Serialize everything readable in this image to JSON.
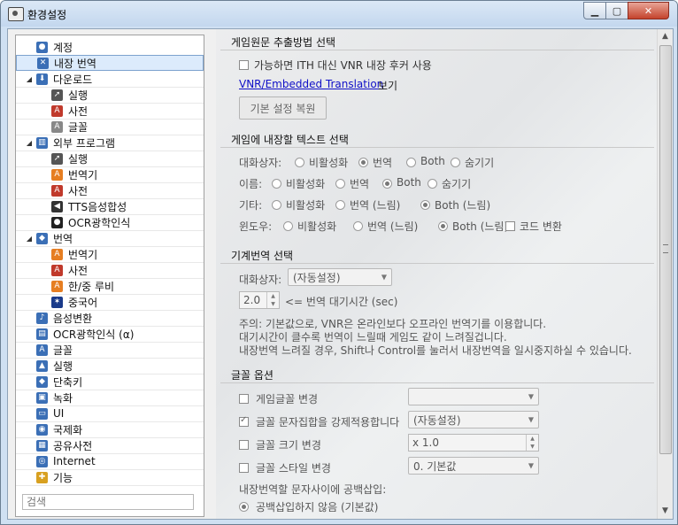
{
  "window": {
    "title": "환경설정"
  },
  "sidebar": {
    "search_placeholder": "검색",
    "items": [
      {
        "label": "계정",
        "icon": "user-icon",
        "color": "#3b6fb6",
        "level": 0
      },
      {
        "label": "내장 번역",
        "icon": "tools-icon",
        "color": "#3b6fb6",
        "level": 0,
        "selected": true
      },
      {
        "label": "다운로드",
        "icon": "download-icon",
        "color": "#3b6fb6",
        "level": 0,
        "expanded": true
      },
      {
        "label": "실행",
        "icon": "rocket-icon",
        "color": "#555555",
        "level": 1
      },
      {
        "label": "사전",
        "icon": "dictionary-icon",
        "color": "#c0392b",
        "level": 1
      },
      {
        "label": "글꼴",
        "icon": "font-icon",
        "color": "#888888",
        "level": 1
      },
      {
        "label": "외부 프로그램",
        "icon": "building-icon",
        "color": "#3b6fb6",
        "level": 0,
        "expanded": true
      },
      {
        "label": "실행",
        "icon": "rocket-icon",
        "color": "#555555",
        "level": 1
      },
      {
        "label": "번역기",
        "icon": "translator-icon",
        "color": "#e67e22",
        "level": 1
      },
      {
        "label": "사전",
        "icon": "dictionary-icon",
        "color": "#c0392b",
        "level": 1
      },
      {
        "label": "TTS음성합성",
        "icon": "speaker-icon",
        "color": "#333333",
        "level": 1
      },
      {
        "label": "OCR광학인식",
        "icon": "camera-icon",
        "color": "#222222",
        "level": 1
      },
      {
        "label": "번역",
        "icon": "people-icon",
        "color": "#3b6fb6",
        "level": 0,
        "expanded": true
      },
      {
        "label": "번역기",
        "icon": "translator-icon",
        "color": "#e67e22",
        "level": 1
      },
      {
        "label": "사전",
        "icon": "dictionary-icon",
        "color": "#c0392b",
        "level": 1
      },
      {
        "label": "한/중 루비",
        "icon": "translator-icon",
        "color": "#e67e22",
        "level": 1
      },
      {
        "label": "중국어",
        "icon": "star-icon",
        "color": "#1a3a8a",
        "level": 1
      },
      {
        "label": "음성변환",
        "icon": "music-icon",
        "color": "#3b6fb6",
        "level": 0
      },
      {
        "label": "OCR광학인식 (α)",
        "icon": "ocr-icon",
        "color": "#3b6fb6",
        "level": 0
      },
      {
        "label": "글꼴",
        "icon": "font-icon",
        "color": "#3b6fb6",
        "level": 0
      },
      {
        "label": "실행",
        "icon": "run-icon",
        "color": "#3b6fb6",
        "level": 0
      },
      {
        "label": "단축키",
        "icon": "shortcut-icon",
        "color": "#3b6fb6",
        "level": 0
      },
      {
        "label": "녹화",
        "icon": "record-icon",
        "color": "#3b6fb6",
        "level": 0
      },
      {
        "label": "UI",
        "icon": "ui-icon",
        "color": "#3b6fb6",
        "level": 0
      },
      {
        "label": "국제화",
        "icon": "globe-icon",
        "color": "#3b6fb6",
        "level": 0
      },
      {
        "label": "공유사전",
        "icon": "share-icon",
        "color": "#3b6fb6",
        "level": 0
      },
      {
        "label": "Internet",
        "icon": "internet-icon",
        "color": "#3b6fb6",
        "level": 0
      },
      {
        "label": "기능",
        "icon": "feature-icon",
        "color": "#d8a020",
        "level": 0
      }
    ]
  },
  "extract": {
    "title": "게임원문 추출방법 선택",
    "checkbox_label": "가능하면 ITH 대신 VNR 내장 후커 사용",
    "link_text": "VNR/Embedded Translation",
    "link_suffix": "보기",
    "reset_button": "기본 설정 복원"
  },
  "embed_text": {
    "title": "게임에 내장할 텍스트 선택",
    "rows": [
      {
        "label": "대화상자:",
        "options": [
          "비활성화",
          "번역",
          "Both",
          "숨기기"
        ],
        "selected": 1
      },
      {
        "label": "이름:",
        "options": [
          "비활성화",
          "번역",
          "Both",
          "숨기기"
        ],
        "selected": 2
      },
      {
        "label": "기타:",
        "options": [
          "비활성화",
          "번역 (느림)",
          "Both (느림)"
        ],
        "selected": 2
      },
      {
        "label": "윈도우:",
        "options": [
          "비활성화",
          "번역 (느림)",
          "Both (느림)"
        ],
        "selected": 2,
        "checkbox": "코드 변환"
      }
    ]
  },
  "machine": {
    "title": "기계번역 선택",
    "dialog_label": "대화상자:",
    "dialog_value": "(자동설정)",
    "wait_value": "2.0",
    "wait_label": "<= 번역 대기시간 (sec)",
    "note1": "주의: 기본값으로, VNR은 온라인보다 오프라인 번역기를 이용합니다.",
    "note2": "대기시간이 클수록 번역이 느릴때 게임도 같이 느려질겁니다.",
    "note3": "내장번역 느려질 경우, Shift나 Control를 눌러서 내장번역을 일시중지하실 수 있습니다."
  },
  "font": {
    "title": "글꼴 옵션",
    "game_font_label": "게임글꼴 변경",
    "game_font_value": "",
    "charset_label": "글꼴 문자집합을 강제적용합니다",
    "charset_value": "(자동설정)",
    "size_label": "글꼴 크기 변경",
    "size_value": "x 1.0",
    "style_label": "글꼴 스타일 변경",
    "style_value": "0. 기본값",
    "spacing_label": "내장번역할 문자사이에 공백삽입:",
    "spacing_option": "공백삽입하지 않음 (기본값)"
  }
}
